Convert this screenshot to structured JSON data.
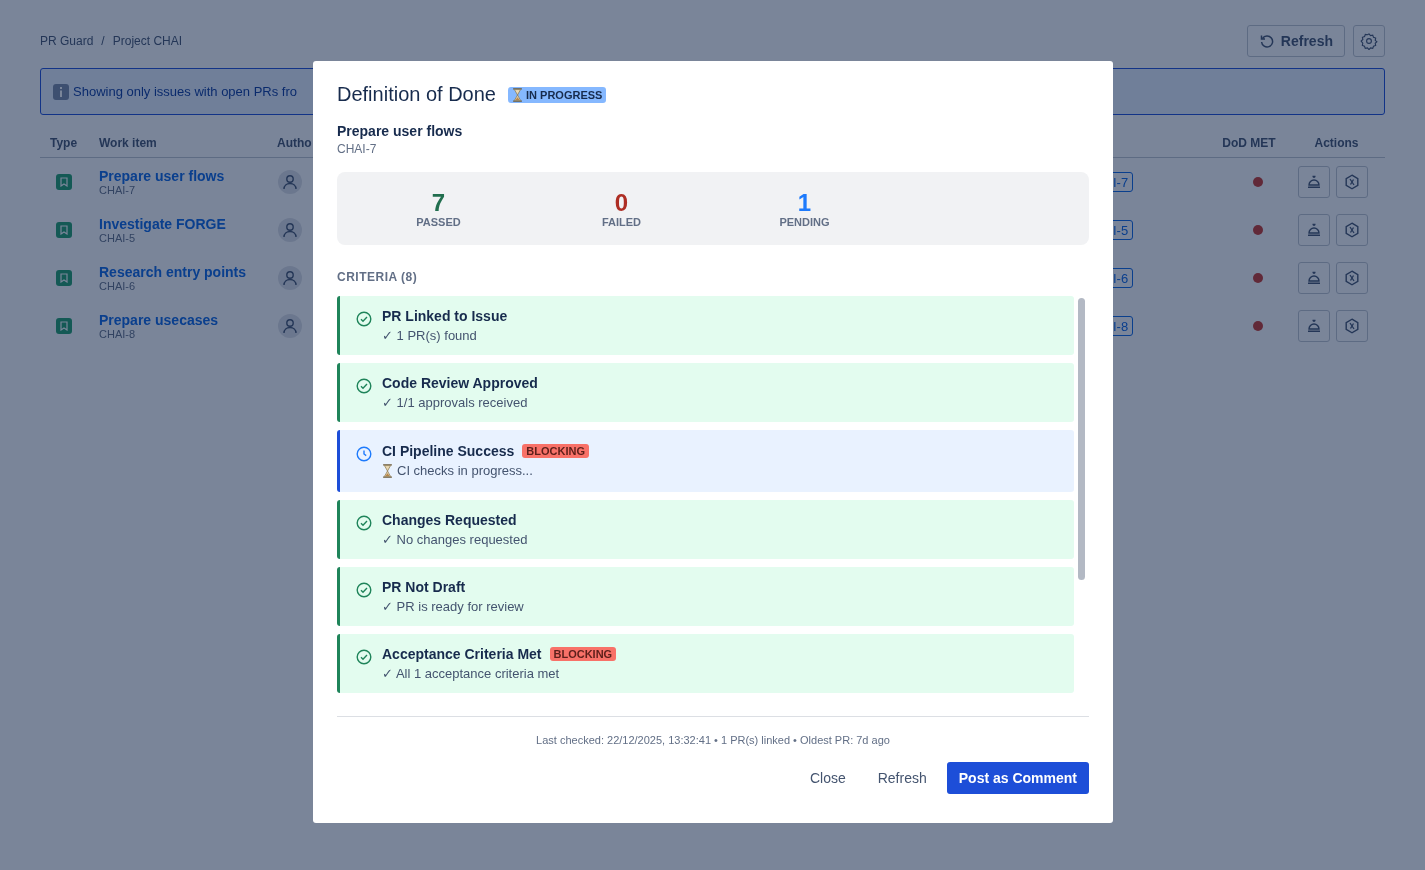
{
  "breadcrumbs": [
    "PR Guard",
    "Project CHAI"
  ],
  "breadcrumb_separator": "/",
  "header_buttons": {
    "refresh": "Refresh"
  },
  "banner": {
    "text": "Showing only issues with open PRs fro"
  },
  "table": {
    "columns": [
      "Type",
      "Work item",
      "Autho",
      "DoD MET",
      "Actions"
    ],
    "rows": [
      {
        "title": "Prepare user flows",
        "key": "CHAI-7",
        "tag": "I-7",
        "dod_met": false
      },
      {
        "title": "Investigate FORGE",
        "key": "CHAI-5",
        "tag": "I-5",
        "dod_met": false
      },
      {
        "title": "Research entry points",
        "key": "CHAI-6",
        "tag": "I-6",
        "dod_met": false
      },
      {
        "title": "Prepare usecases",
        "key": "CHAI-8",
        "tag": "I-8",
        "dod_met": false
      }
    ]
  },
  "dialog": {
    "title": "Definition of Done",
    "status_badge": "IN PROGRESS",
    "item_title": "Prepare user flows",
    "item_key": "CHAI-7",
    "stats": [
      {
        "kind": "passed",
        "value": "7",
        "label": "PASSED"
      },
      {
        "kind": "failed",
        "value": "0",
        "label": "FAILED"
      },
      {
        "kind": "pending",
        "value": "1",
        "label": "PENDING"
      }
    ],
    "criteria_heading": "CRITERIA (8)",
    "criteria": [
      {
        "kind": "passed",
        "name": "PR Linked to Issue",
        "detail": "✓ 1 PR(s) found",
        "blocking": false
      },
      {
        "kind": "passed",
        "name": "Code Review Approved",
        "detail": "✓ 1/1 approvals received",
        "blocking": false
      },
      {
        "kind": "pending",
        "name": "CI Pipeline Success",
        "detail": "CI checks in progress...",
        "blocking": true,
        "badge": "BLOCKING"
      },
      {
        "kind": "passed",
        "name": "Changes Requested",
        "detail": "✓ No changes requested",
        "blocking": false
      },
      {
        "kind": "passed",
        "name": "PR Not Draft",
        "detail": "✓ PR is ready for review",
        "blocking": false
      },
      {
        "kind": "passed",
        "name": "Acceptance Criteria Met",
        "detail": "✓ All 1 acceptance criteria met",
        "blocking": true,
        "badge": "BLOCKING"
      }
    ],
    "footer_text": "Last checked: 22/12/2025, 13:32:41 • 1 PR(s) linked • Oldest PR: 7d ago",
    "buttons": [
      {
        "kind": "subtle",
        "label": "Close"
      },
      {
        "kind": "subtle",
        "label": "Refresh"
      },
      {
        "kind": "primary",
        "label": "Post as Comment"
      }
    ]
  }
}
